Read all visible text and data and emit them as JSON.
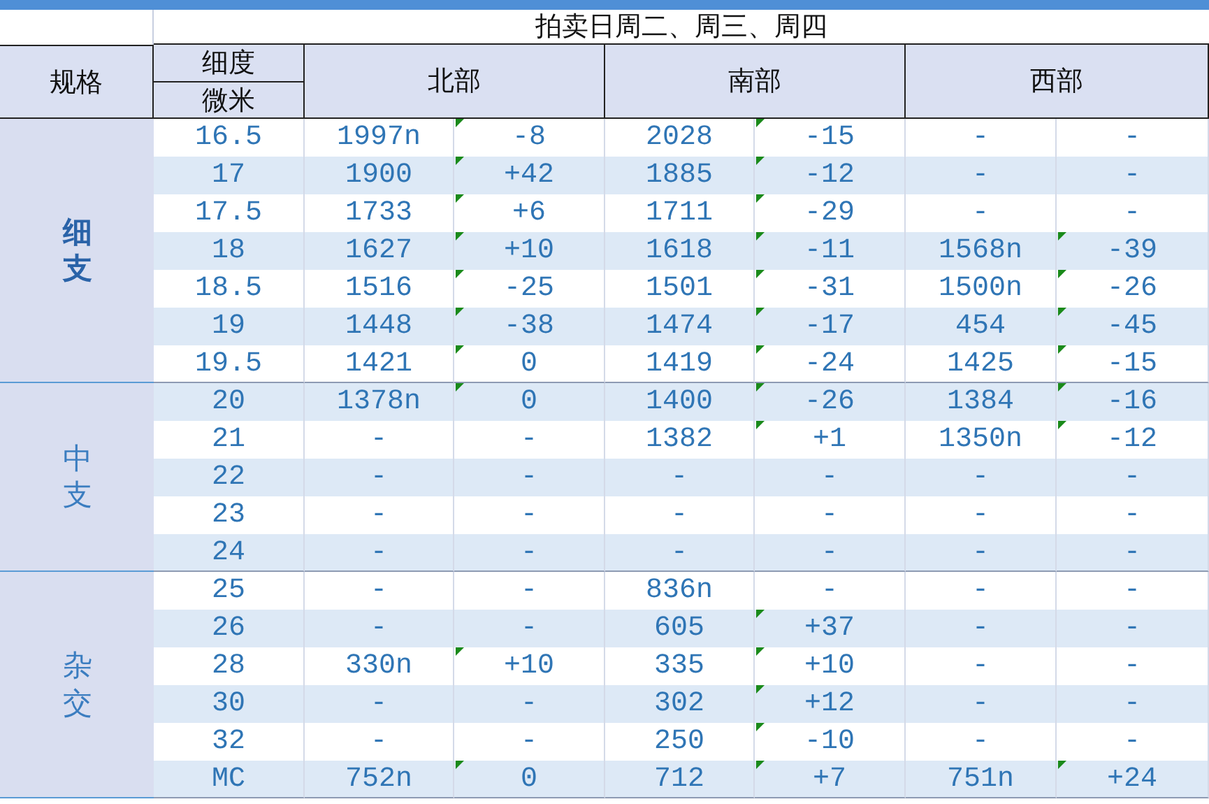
{
  "title": "拍卖日周二、周三、周四",
  "header": {
    "spec": "规格",
    "micron_top": "细度",
    "micron_bottom": "微米",
    "regions": [
      "北部",
      "南部",
      "西部"
    ]
  },
  "groups": [
    {
      "label": "细支",
      "emphasis": true,
      "rows": [
        {
          "micron": "16.5",
          "cells": [
            {
              "text": "1997n",
              "flag": false
            },
            {
              "text": "-8",
              "flag": true
            },
            {
              "text": "2028",
              "flag": false
            },
            {
              "text": "-15",
              "flag": true
            },
            {
              "text": "-",
              "flag": false
            },
            {
              "text": "-",
              "flag": false
            }
          ]
        },
        {
          "micron": "17",
          "cells": [
            {
              "text": "1900",
              "flag": false
            },
            {
              "text": "+42",
              "flag": true
            },
            {
              "text": "1885",
              "flag": false
            },
            {
              "text": "-12",
              "flag": true
            },
            {
              "text": "-",
              "flag": false
            },
            {
              "text": "-",
              "flag": false
            }
          ]
        },
        {
          "micron": "17.5",
          "cells": [
            {
              "text": "1733",
              "flag": false
            },
            {
              "text": "+6",
              "flag": true
            },
            {
              "text": "1711",
              "flag": false
            },
            {
              "text": "-29",
              "flag": true
            },
            {
              "text": "-",
              "flag": false
            },
            {
              "text": "-",
              "flag": false
            }
          ]
        },
        {
          "micron": "18",
          "cells": [
            {
              "text": "1627",
              "flag": false
            },
            {
              "text": "+10",
              "flag": true
            },
            {
              "text": "1618",
              "flag": false
            },
            {
              "text": "-11",
              "flag": true
            },
            {
              "text": "1568n",
              "flag": false
            },
            {
              "text": "-39",
              "flag": true
            }
          ]
        },
        {
          "micron": "18.5",
          "cells": [
            {
              "text": "1516",
              "flag": false
            },
            {
              "text": "-25",
              "flag": true
            },
            {
              "text": "1501",
              "flag": false
            },
            {
              "text": "-31",
              "flag": true
            },
            {
              "text": "1500n",
              "flag": false
            },
            {
              "text": "-26",
              "flag": true
            }
          ]
        },
        {
          "micron": "19",
          "cells": [
            {
              "text": "1448",
              "flag": false
            },
            {
              "text": "-38",
              "flag": true
            },
            {
              "text": "1474",
              "flag": false
            },
            {
              "text": "-17",
              "flag": true
            },
            {
              "text": "454",
              "flag": false
            },
            {
              "text": "-45",
              "flag": true
            }
          ]
        },
        {
          "micron": "19.5",
          "cells": [
            {
              "text": "1421",
              "flag": false
            },
            {
              "text": "0",
              "flag": true
            },
            {
              "text": "1419",
              "flag": false
            },
            {
              "text": "-24",
              "flag": true
            },
            {
              "text": "1425",
              "flag": false
            },
            {
              "text": "-15",
              "flag": true
            }
          ]
        }
      ]
    },
    {
      "label": "中支",
      "emphasis": false,
      "rows": [
        {
          "micron": "20",
          "cells": [
            {
              "text": "1378n",
              "flag": false
            },
            {
              "text": "0",
              "flag": true
            },
            {
              "text": "1400",
              "flag": false
            },
            {
              "text": "-26",
              "flag": true
            },
            {
              "text": "1384",
              "flag": false
            },
            {
              "text": "-16",
              "flag": true
            }
          ]
        },
        {
          "micron": "21",
          "cells": [
            {
              "text": "-",
              "flag": false
            },
            {
              "text": "-",
              "flag": false
            },
            {
              "text": "1382",
              "flag": false
            },
            {
              "text": "+1",
              "flag": true
            },
            {
              "text": "1350n",
              "flag": false
            },
            {
              "text": "-12",
              "flag": true
            }
          ]
        },
        {
          "micron": "22",
          "cells": [
            {
              "text": "-",
              "flag": false
            },
            {
              "text": "-",
              "flag": false
            },
            {
              "text": "-",
              "flag": false
            },
            {
              "text": "-",
              "flag": false
            },
            {
              "text": "-",
              "flag": false
            },
            {
              "text": "-",
              "flag": false
            }
          ]
        },
        {
          "micron": "23",
          "cells": [
            {
              "text": "-",
              "flag": false
            },
            {
              "text": "-",
              "flag": false
            },
            {
              "text": "-",
              "flag": false
            },
            {
              "text": "-",
              "flag": false
            },
            {
              "text": "-",
              "flag": false
            },
            {
              "text": "-",
              "flag": false
            }
          ]
        },
        {
          "micron": "24",
          "cells": [
            {
              "text": "-",
              "flag": false
            },
            {
              "text": "-",
              "flag": false
            },
            {
              "text": "-",
              "flag": false
            },
            {
              "text": "-",
              "flag": false
            },
            {
              "text": "-",
              "flag": false
            },
            {
              "text": "-",
              "flag": false
            }
          ]
        }
      ]
    },
    {
      "label": "杂交",
      "emphasis": false,
      "rows": [
        {
          "micron": "25",
          "cells": [
            {
              "text": "-",
              "flag": false
            },
            {
              "text": "-",
              "flag": false
            },
            {
              "text": "836n",
              "flag": false
            },
            {
              "text": "-",
              "flag": false
            },
            {
              "text": "-",
              "flag": false
            },
            {
              "text": "-",
              "flag": false
            }
          ]
        },
        {
          "micron": "26",
          "cells": [
            {
              "text": "-",
              "flag": false
            },
            {
              "text": "-",
              "flag": false
            },
            {
              "text": "605",
              "flag": false
            },
            {
              "text": "+37",
              "flag": true
            },
            {
              "text": "-",
              "flag": false
            },
            {
              "text": "-",
              "flag": false
            }
          ]
        },
        {
          "micron": "28",
          "cells": [
            {
              "text": "330n",
              "flag": false
            },
            {
              "text": "+10",
              "flag": true
            },
            {
              "text": "335",
              "flag": false
            },
            {
              "text": "+10",
              "flag": true
            },
            {
              "text": "-",
              "flag": false
            },
            {
              "text": "-",
              "flag": false
            }
          ]
        },
        {
          "micron": "30",
          "cells": [
            {
              "text": "-",
              "flag": false
            },
            {
              "text": "-",
              "flag": false
            },
            {
              "text": "302",
              "flag": false
            },
            {
              "text": "+12",
              "flag": true
            },
            {
              "text": "-",
              "flag": false
            },
            {
              "text": "-",
              "flag": false
            }
          ]
        },
        {
          "micron": "32",
          "cells": [
            {
              "text": "-",
              "flag": false
            },
            {
              "text": "-",
              "flag": false
            },
            {
              "text": "250",
              "flag": false
            },
            {
              "text": "-10",
              "flag": true
            },
            {
              "text": "-",
              "flag": false
            },
            {
              "text": "-",
              "flag": false
            }
          ]
        },
        {
          "micron": "MC",
          "cells": [
            {
              "text": "752n",
              "flag": false
            },
            {
              "text": "0",
              "flag": true
            },
            {
              "text": "712",
              "flag": false
            },
            {
              "text": "+7",
              "flag": true
            },
            {
              "text": "751n",
              "flag": false
            },
            {
              "text": "+24",
              "flag": true
            }
          ]
        }
      ]
    }
  ]
}
